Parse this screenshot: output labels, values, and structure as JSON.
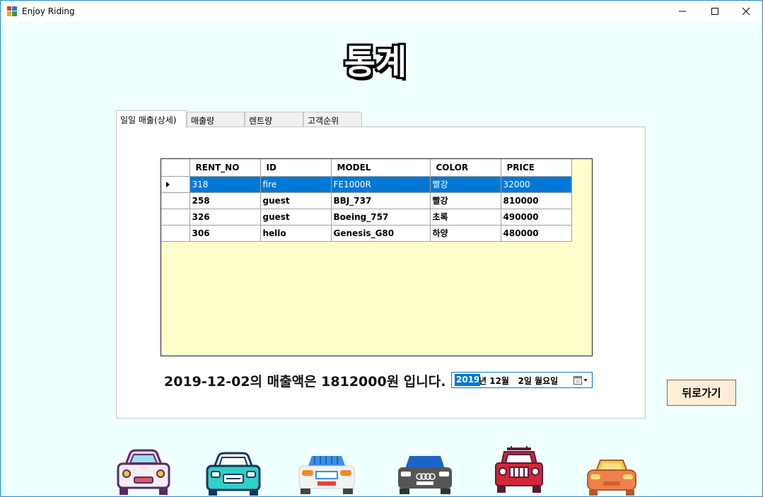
{
  "window": {
    "title": "Enjoy Riding"
  },
  "page": {
    "title": "통계"
  },
  "tabs": [
    {
      "label": "일일 매출(상세)"
    },
    {
      "label": "매출량"
    },
    {
      "label": "렌트량"
    },
    {
      "label": "고객순위"
    }
  ],
  "grid": {
    "columns": [
      "RENT_NO",
      "ID",
      "MODEL",
      "COLOR",
      "PRICE"
    ],
    "rows": [
      [
        "318",
        "fire",
        "FE1000R",
        "빨강",
        "32000"
      ],
      [
        "258",
        "guest",
        "BBJ_737",
        "빨강",
        "810000"
      ],
      [
        "326",
        "guest",
        "Boeing_757",
        "초록",
        "490000"
      ],
      [
        "306",
        "hello",
        "Genesis_G80",
        "하양",
        "480000"
      ]
    ],
    "selected_row": 0
  },
  "summary": {
    "text": "2019-12-02의 매출액은 1812000원 입니다."
  },
  "datepicker": {
    "year": "2019",
    "rest": "년 12월   2일 월요일"
  },
  "buttons": {
    "back_label": "뒤로가기"
  },
  "colors": {
    "selection": "#0078d7",
    "grid_background": "#ffffcc",
    "window_background": "#f0ffff",
    "back_button": "#ffeed5"
  },
  "icons": [
    "app-icon",
    "minimize-icon",
    "maximize-icon",
    "close-icon",
    "calendar-icon",
    "row-pointer-icon",
    "car-icon"
  ]
}
